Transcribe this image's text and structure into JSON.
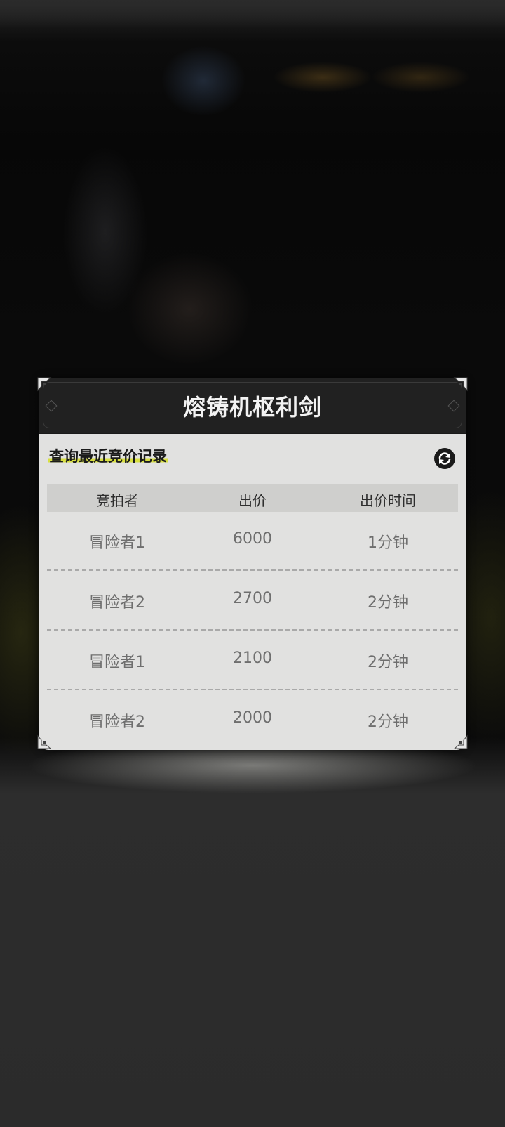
{
  "dialog": {
    "title": "熔铸机枢利剑",
    "section_title": "查询最近竞价记录",
    "refresh_icon": "refresh-icon",
    "columns": [
      "竞拍者",
      "出价",
      "出价时间"
    ],
    "rows": [
      {
        "bidder": "冒险者1",
        "price": "6000",
        "time": "1分钟"
      },
      {
        "bidder": "冒险者2",
        "price": "2700",
        "time": "2分钟"
      },
      {
        "bidder": "冒险者1",
        "price": "2100",
        "time": "2分钟"
      },
      {
        "bidder": "冒险者2",
        "price": "2000",
        "time": "2分钟"
      }
    ]
  },
  "colors": {
    "header_bg": "#212121",
    "panel_bg": "#e1e1e0",
    "highlight": "#d8e040"
  }
}
